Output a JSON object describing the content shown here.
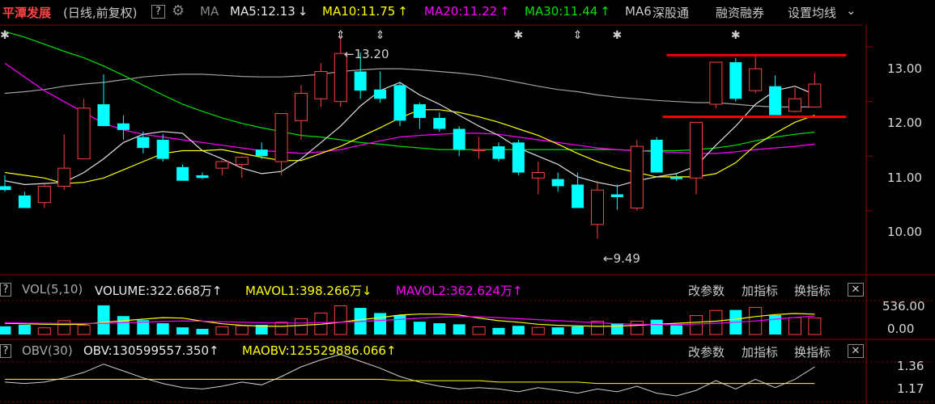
{
  "header": {
    "stock_name": "平潭发展",
    "adjust_mode": "(日线,前复权)",
    "help_label": "?",
    "ma_label": "MA",
    "ma5": "MA5:12.13",
    "ma10": "MA10:11.75",
    "ma20": "MA20:11.22",
    "ma30": "MA30:11.44",
    "ma60": "MA6",
    "exchange": "深股通",
    "margin_trading": "融资融券",
    "settings": "设置均线",
    "arrow_down": "↓",
    "arrow_up": "↑"
  },
  "colors": {
    "up": "#ff4040",
    "down": "#00ffff",
    "ma5": "#e0e0e0",
    "ma10": "#ffff00",
    "ma20": "#ff00ff",
    "ma30": "#00e000",
    "ma60": "#a0a0a0",
    "annotation": "#ff0000",
    "grid": "#8b0000"
  },
  "price_panel": {
    "y_ticks": [
      "13.00",
      "12.00",
      "11.00",
      "10.00"
    ],
    "high_label": "13.20",
    "low_label": "9.49"
  },
  "vol_panel": {
    "title": "VOL(5,10)",
    "volume": "VOLUME:322.668万",
    "mavol1": "MAVOL1:398.266万",
    "mavol2": "MAVOL2:362.624万",
    "arrow_up": "↑",
    "arrow_down": "↓",
    "y_ticks": [
      "536.00",
      "0.00"
    ],
    "buttons": {
      "params": "改参数",
      "add": "加指标",
      "switch": "换指标"
    },
    "close": "✕",
    "help": "?"
  },
  "obv_panel": {
    "title": "OBV(30)",
    "obv": "OBV:130599557.350",
    "maobv": "MAOBV:125529886.066",
    "arrow_up": "↑",
    "y_ticks": [
      "1.36",
      "1.17"
    ],
    "buttons": {
      "params": "改参数",
      "add": "加指标",
      "switch": "换指标"
    },
    "close": "✕",
    "help": "?"
  },
  "chart_data": {
    "type": "candlestick",
    "title": "平潭发展 (日线,前复权)",
    "ylim": [
      9.3,
      13.6
    ],
    "candles": [
      {
        "o": 10.45,
        "h": 10.65,
        "l": 10.35,
        "c": 10.38,
        "v": 160
      },
      {
        "o": 10.28,
        "h": 10.35,
        "l": 10.05,
        "c": 10.05,
        "v": 190
      },
      {
        "o": 10.15,
        "h": 10.48,
        "l": 10.05,
        "c": 10.45,
        "v": 130
      },
      {
        "o": 10.45,
        "h": 11.4,
        "l": 10.38,
        "c": 10.78,
        "v": 270
      },
      {
        "o": 10.95,
        "h": 12.05,
        "l": 10.95,
        "c": 11.88,
        "v": 180
      },
      {
        "o": 11.95,
        "h": 12.5,
        "l": 11.7,
        "c": 11.55,
        "v": 570
      },
      {
        "o": 11.6,
        "h": 11.75,
        "l": 11.3,
        "c": 11.48,
        "v": 360
      },
      {
        "o": 11.35,
        "h": 11.45,
        "l": 11.05,
        "c": 11.15,
        "v": 280
      },
      {
        "o": 11.3,
        "h": 11.4,
        "l": 10.9,
        "c": 10.95,
        "v": 220
      },
      {
        "o": 10.8,
        "h": 10.85,
        "l": 10.55,
        "c": 10.55,
        "v": 140
      },
      {
        "o": 10.65,
        "h": 10.7,
        "l": 10.58,
        "c": 10.6,
        "v": 110
      },
      {
        "o": 10.78,
        "h": 10.92,
        "l": 10.65,
        "c": 10.9,
        "v": 150
      },
      {
        "o": 10.85,
        "h": 11.0,
        "l": 10.6,
        "c": 10.98,
        "v": 170
      },
      {
        "o": 11.12,
        "h": 11.25,
        "l": 10.95,
        "c": 11.0,
        "v": 190
      },
      {
        "o": 10.9,
        "h": 11.55,
        "l": 10.65,
        "c": 11.78,
        "v": 240
      },
      {
        "o": 11.65,
        "h": 12.3,
        "l": 11.3,
        "c": 12.15,
        "v": 310
      },
      {
        "o": 12.05,
        "h": 12.7,
        "l": 11.9,
        "c": 12.55,
        "v": 420
      },
      {
        "o": 12.0,
        "h": 13.2,
        "l": 11.9,
        "c": 12.88,
        "v": 560
      },
      {
        "o": 12.55,
        "h": 12.9,
        "l": 12.05,
        "c": 12.2,
        "v": 520
      },
      {
        "o": 12.22,
        "h": 12.55,
        "l": 11.98,
        "c": 12.05,
        "v": 420
      },
      {
        "o": 12.3,
        "h": 12.35,
        "l": 11.55,
        "c": 11.65,
        "v": 380
      },
      {
        "o": 11.95,
        "h": 11.98,
        "l": 11.5,
        "c": 11.7,
        "v": 250
      },
      {
        "o": 11.7,
        "h": 11.8,
        "l": 11.45,
        "c": 11.5,
        "v": 220
      },
      {
        "o": 11.5,
        "h": 11.55,
        "l": 11.0,
        "c": 11.12,
        "v": 200
      },
      {
        "o": 11.1,
        "h": 11.35,
        "l": 10.95,
        "c": 11.12,
        "v": 150
      },
      {
        "o": 11.18,
        "h": 11.25,
        "l": 10.9,
        "c": 10.95,
        "v": 130
      },
      {
        "o": 11.25,
        "h": 11.3,
        "l": 10.65,
        "c": 10.7,
        "v": 170
      },
      {
        "o": 10.6,
        "h": 10.9,
        "l": 10.3,
        "c": 10.7,
        "v": 140
      },
      {
        "o": 10.58,
        "h": 10.7,
        "l": 10.35,
        "c": 10.45,
        "v": 140
      },
      {
        "o": 10.48,
        "h": 10.7,
        "l": 10.05,
        "c": 10.05,
        "v": 160
      },
      {
        "o": 9.75,
        "h": 10.55,
        "l": 9.49,
        "c": 10.38,
        "v": 260
      },
      {
        "o": 10.3,
        "h": 10.48,
        "l": 10.02,
        "c": 10.25,
        "v": 220
      },
      {
        "o": 10.05,
        "h": 11.3,
        "l": 10.0,
        "c": 11.18,
        "v": 260
      },
      {
        "o": 11.3,
        "h": 11.35,
        "l": 10.75,
        "c": 10.7,
        "v": 290
      },
      {
        "o": 10.62,
        "h": 10.68,
        "l": 10.55,
        "c": 10.58,
        "v": 180
      },
      {
        "o": 10.6,
        "h": 11.6,
        "l": 10.3,
        "c": 11.62,
        "v": 370
      },
      {
        "o": 11.95,
        "h": 12.72,
        "l": 11.88,
        "c": 12.72,
        "v": 470
      },
      {
        "o": 12.72,
        "h": 12.8,
        "l": 12.0,
        "c": 12.05,
        "v": 480
      },
      {
        "o": 12.2,
        "h": 12.85,
        "l": 12.15,
        "c": 12.6,
        "v": 530
      },
      {
        "o": 12.28,
        "h": 12.48,
        "l": 11.75,
        "c": 11.75,
        "v": 380
      },
      {
        "o": 11.82,
        "h": 12.25,
        "l": 11.8,
        "c": 12.05,
        "v": 330
      },
      {
        "o": 11.9,
        "h": 12.52,
        "l": 11.9,
        "c": 12.32,
        "v": 323
      }
    ],
    "ma5": [
      10.55,
      10.48,
      10.5,
      10.52,
      10.7,
      10.95,
      11.25,
      11.4,
      11.45,
      11.42,
      11.1,
      10.95,
      10.78,
      10.68,
      10.72,
      10.95,
      11.25,
      11.55,
      11.92,
      12.2,
      12.35,
      12.12,
      11.95,
      11.75,
      11.55,
      11.38,
      11.15,
      11.0,
      10.85,
      10.62,
      10.52,
      10.45,
      10.55,
      10.62,
      10.68,
      10.82,
      11.2,
      11.55,
      11.95,
      12.2,
      12.28,
      12.13
    ],
    "ma10": [
      10.7,
      10.65,
      10.6,
      10.5,
      10.52,
      10.6,
      10.75,
      10.9,
      11.05,
      11.1,
      11.1,
      11.12,
      11.05,
      10.98,
      10.92,
      10.92,
      11.05,
      11.18,
      11.35,
      11.52,
      11.7,
      11.85,
      11.85,
      11.8,
      11.72,
      11.62,
      11.5,
      11.38,
      11.22,
      11.05,
      10.9,
      10.78,
      10.7,
      10.62,
      10.62,
      10.62,
      10.68,
      10.88,
      11.2,
      11.42,
      11.62,
      11.75
    ],
    "ma20": [
      12.7,
      12.45,
      12.2,
      12.0,
      11.8,
      11.6,
      11.48,
      11.4,
      11.35,
      11.3,
      11.25,
      11.2,
      11.15,
      11.1,
      11.08,
      11.05,
      11.08,
      11.12,
      11.2,
      11.28,
      11.35,
      11.38,
      11.4,
      11.42,
      11.42,
      11.4,
      11.35,
      11.3,
      11.25,
      11.2,
      11.15,
      11.12,
      11.1,
      11.08,
      11.07,
      11.05,
      11.05,
      11.08,
      11.12,
      11.15,
      11.18,
      11.22
    ],
    "ma30": [
      13.28,
      13.18,
      13.05,
      12.92,
      12.8,
      12.65,
      12.48,
      12.3,
      12.12,
      11.95,
      11.82,
      11.7,
      11.6,
      11.52,
      11.45,
      11.38,
      11.35,
      11.3,
      11.25,
      11.22,
      11.18,
      11.15,
      11.12,
      11.12,
      11.12,
      11.12,
      11.12,
      11.12,
      11.12,
      11.12,
      11.12,
      11.12,
      11.1,
      11.1,
      11.1,
      11.12,
      11.15,
      11.2,
      11.28,
      11.35,
      11.4,
      11.44
    ],
    "ma60": [
      12.15,
      12.18,
      12.22,
      12.28,
      12.32,
      12.35,
      12.4,
      12.45,
      12.48,
      12.5,
      12.5,
      12.48,
      12.46,
      12.45,
      12.45,
      12.47,
      12.5,
      12.55,
      12.58,
      12.6,
      12.6,
      12.58,
      12.55,
      12.52,
      12.48,
      12.42,
      12.35,
      12.28,
      12.22,
      12.18,
      12.12,
      12.08,
      12.05,
      12.02,
      12.0,
      11.98,
      11.98,
      11.95,
      11.92,
      11.9,
      11.9,
      11.9
    ],
    "annotation_lines": [
      {
        "i0": 33.5,
        "i1": 42.6,
        "y": 12.85
      },
      {
        "i0": 33.3,
        "i1": 42.6,
        "y": 11.72
      }
    ],
    "event_markers": [
      {
        "i": 0,
        "symbol": "✱"
      },
      {
        "i": 17,
        "symbol": "⇕"
      },
      {
        "i": 19,
        "symbol": "⇕"
      },
      {
        "i": 26,
        "symbol": "✱"
      },
      {
        "i": 29,
        "symbol": "⇕"
      },
      {
        "i": 31,
        "symbol": "✱"
      },
      {
        "i": 37,
        "symbol": "✱"
      }
    ],
    "vol_ylim": [
      0,
      600
    ],
    "mavol1": [
      220,
      210,
      200,
      195,
      200,
      240,
      270,
      300,
      330,
      320,
      260,
      210,
      180,
      165,
      160,
      180,
      200,
      240,
      290,
      330,
      380,
      400,
      400,
      380,
      320,
      270,
      240,
      200,
      180,
      170,
      160,
      165,
      180,
      200,
      220,
      240,
      260,
      300,
      350,
      390,
      410,
      398
    ],
    "mavol2": [
      230,
      225,
      220,
      215,
      215,
      220,
      230,
      240,
      255,
      265,
      260,
      250,
      240,
      230,
      225,
      225,
      230,
      240,
      255,
      275,
      295,
      320,
      340,
      350,
      345,
      330,
      310,
      290,
      270,
      250,
      230,
      210,
      200,
      195,
      195,
      205,
      220,
      240,
      265,
      300,
      335,
      362
    ],
    "obv_ylim": [
      1.1,
      1.45
    ],
    "obv": [
      1.2,
      1.19,
      1.2,
      1.23,
      1.27,
      1.33,
      1.28,
      1.23,
      1.19,
      1.16,
      1.15,
      1.17,
      1.2,
      1.18,
      1.24,
      1.31,
      1.36,
      1.4,
      1.35,
      1.3,
      1.24,
      1.2,
      1.17,
      1.15,
      1.16,
      1.15,
      1.13,
      1.16,
      1.14,
      1.12,
      1.15,
      1.13,
      1.17,
      1.12,
      1.1,
      1.14,
      1.21,
      1.15,
      1.22,
      1.16,
      1.22,
      1.31
    ],
    "maobv": [
      1.22,
      1.22,
      1.22,
      1.22,
      1.22,
      1.22,
      1.22,
      1.22,
      1.22,
      1.22,
      1.22,
      1.22,
      1.22,
      1.22,
      1.22,
      1.22,
      1.22,
      1.22,
      1.22,
      1.22,
      1.21,
      1.21,
      1.21,
      1.21,
      1.21,
      1.2,
      1.2,
      1.2,
      1.2,
      1.2,
      1.19,
      1.19,
      1.19,
      1.19,
      1.19,
      1.19,
      1.19,
      1.19,
      1.19,
      1.19,
      1.19,
      1.19
    ]
  }
}
